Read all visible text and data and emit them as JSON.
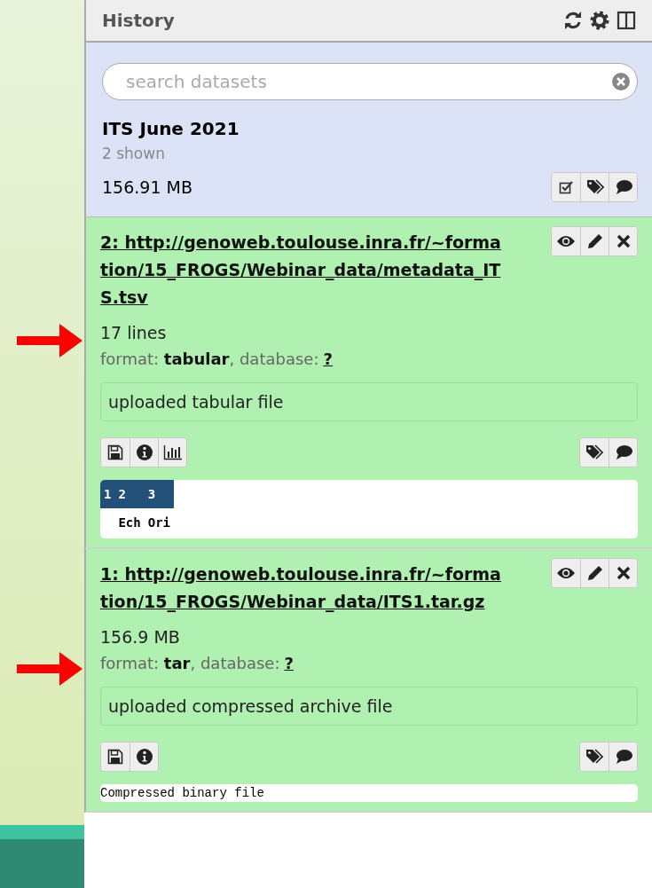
{
  "panel": {
    "title": "History"
  },
  "search": {
    "placeholder": "search datasets"
  },
  "history": {
    "name": "ITS June 2021",
    "shown": "2 shown",
    "size": "156.91 MB"
  },
  "datasets": [
    {
      "title": "2: http://genoweb.toulouse.inra.fr/~formation/15_FROGS/Webinar_data/metadata_ITS.tsv",
      "summary": "17 lines",
      "arrow": true,
      "format_line": "format: **tabular**, database:",
      "database": "?",
      "description": "uploaded tabular file",
      "visualize": true,
      "peek": {
        "kind": "table",
        "columns": [
          "1",
          "2",
          "3"
        ],
        "rows": [
          [
            "",
            "Ech",
            "Ori"
          ]
        ]
      }
    },
    {
      "title": "1: http://genoweb.toulouse.inra.fr/~formation/15_FROGS/Webinar_data/ITS1.tar.gz",
      "summary": "156.9 MB",
      "arrow": true,
      "format_line": "format: **tar**, database:",
      "database": "?",
      "description": "uploaded compressed archive file",
      "visualize": false,
      "peek": {
        "kind": "text",
        "text": "Compressed binary file"
      }
    }
  ]
}
